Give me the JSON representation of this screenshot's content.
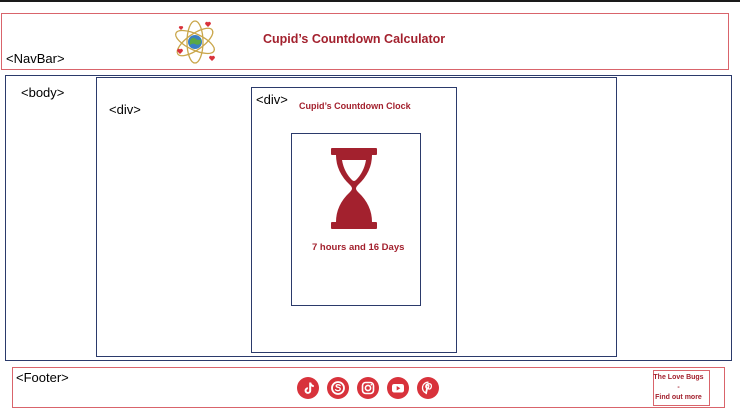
{
  "navbar": {
    "tag": "<NavBar>",
    "title": "Cupid’s Countdown Calculator",
    "logo_icon": "atom-globe-hearts-icon"
  },
  "body_section": {
    "tag": "<body>"
  },
  "outer_div": {
    "tag": "<div>"
  },
  "inner_div": {
    "tag": "<div>",
    "heading": "Cupid’s Countdown Clock"
  },
  "clock": {
    "icon": "hourglass-icon",
    "countdown_text": "7 hours and 16 Days"
  },
  "footer": {
    "tag": "<Footer>",
    "social_icons": [
      "tiktok-icon",
      "skype-icon",
      "instagram-icon",
      "youtube-icon",
      "pinterest-icon"
    ],
    "love_bugs": {
      "line1": "The Love Bugs",
      "line2": "-",
      "line3": "Find out more"
    }
  },
  "colors": {
    "accent_red": "#a3212e",
    "icon_red": "#d8323b",
    "border_red": "#d9646b",
    "border_navy": "#2b3a6b"
  }
}
